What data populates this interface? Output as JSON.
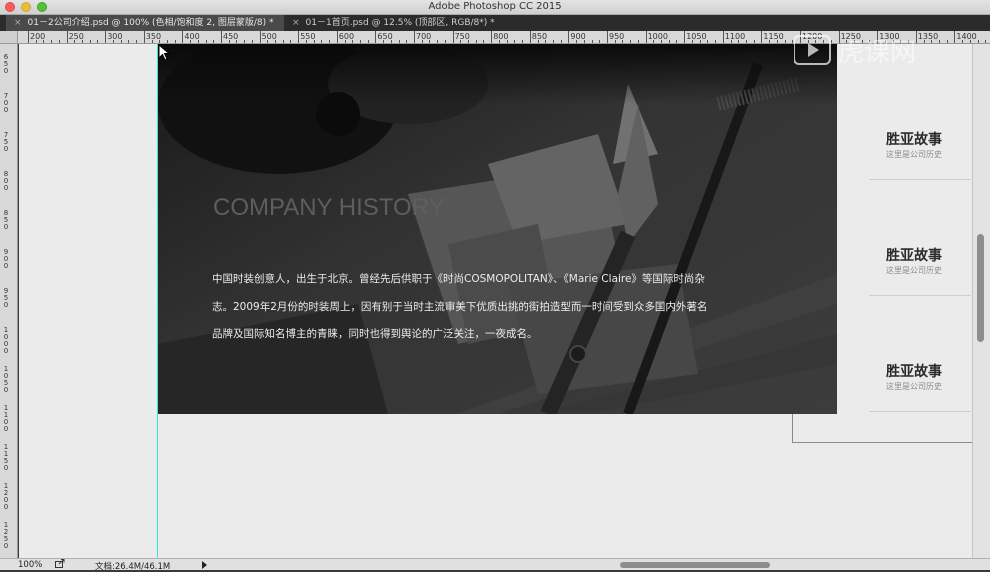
{
  "app": {
    "title": "Adobe Photoshop CC 2015"
  },
  "tabs": [
    {
      "close": "×",
      "label": "01－2公司介绍.psd @ 100% (色相/饱和度 2, 图层蒙版/8) *",
      "active": true
    },
    {
      "close": "×",
      "label": "01－1首页.psd @ 12.5% (顶部区, RGB/8*) *",
      "active": false
    }
  ],
  "ruler": {
    "top_labels": [
      "200",
      "250",
      "300",
      "350",
      "400",
      "450",
      "500",
      "550",
      "600",
      "650",
      "700",
      "750",
      "800",
      "850",
      "900",
      "950",
      "1000",
      "1050",
      "1100",
      "1150",
      "1200",
      "1250",
      "1300",
      "1350",
      "1400"
    ],
    "left_labels": [
      "650",
      "700",
      "750",
      "800",
      "850",
      "900",
      "950",
      "1000",
      "1050",
      "1100",
      "1150",
      "1200",
      "1250"
    ]
  },
  "content": {
    "heading": "COMPANY HISTORY",
    "paragraph": "中国时装创意人，出生于北京。曾经先后供职于《时尚COSMOPOLITAN》、《Marie Claire》等国际时尚杂志。2009年2月份的时装周上，因有别于当时主流审美下优质出挑的街拍造型而一时间受到众多国内外著名品牌及国际知名博主的青睐，同时也得到舆论的广泛关注，一夜成名。"
  },
  "side_items": [
    {
      "title": "胜亚故事",
      "subtitle": "这里是公司历史"
    },
    {
      "title": "胜亚故事",
      "subtitle": "这里是公司历史"
    },
    {
      "title": "胜亚故事",
      "subtitle": "这里是公司历史"
    }
  ],
  "status": {
    "zoom": "100%",
    "doc_info": "文档:26.4M/46.1M"
  },
  "watermark": {
    "text": "虎课网"
  },
  "colors": {
    "guide": "#2ee8e8",
    "canvas_bg": "#ebebeb",
    "photo_tone": "#3d3d3d"
  }
}
